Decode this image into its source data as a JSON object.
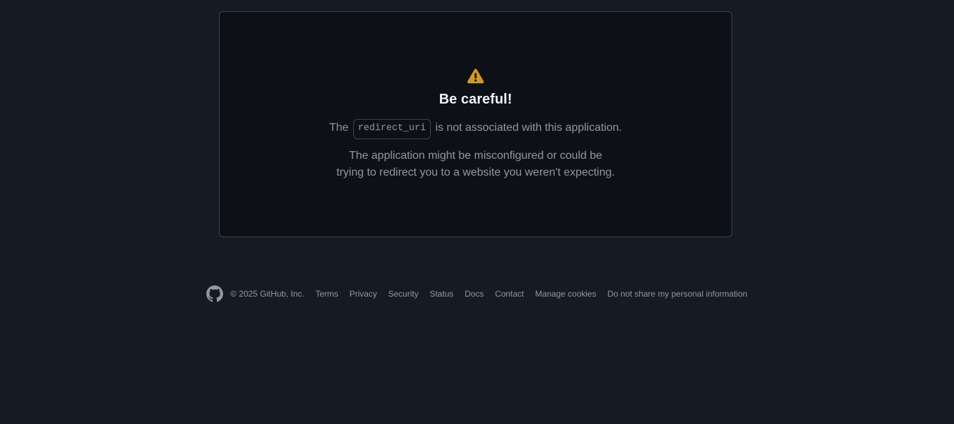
{
  "colors": {
    "page_background": "#151b23",
    "card_background": "#0d1117",
    "card_border": "#3d444d",
    "heading_text": "#f0f6fc",
    "body_text": "#9198a1",
    "warning_amber": "#d29922",
    "link_hover": "#4493f8"
  },
  "card": {
    "icon": "warning-triangle-icon",
    "title": "Be careful!",
    "message_prefix": "The",
    "code_token": "redirect_uri",
    "message_suffix": "is not associated with this application.",
    "sub_message_line1": "The application might be misconfigured or could be",
    "sub_message_line2": "trying to redirect you to a website you weren't expecting."
  },
  "footer": {
    "logo": "github-mark-icon",
    "copyright": "© 2025 GitHub, Inc.",
    "links": [
      {
        "label": "Terms"
      },
      {
        "label": "Privacy"
      },
      {
        "label": "Security"
      },
      {
        "label": "Status"
      },
      {
        "label": "Docs"
      },
      {
        "label": "Contact"
      },
      {
        "label": "Manage cookies"
      },
      {
        "label": "Do not share my personal information"
      }
    ]
  }
}
